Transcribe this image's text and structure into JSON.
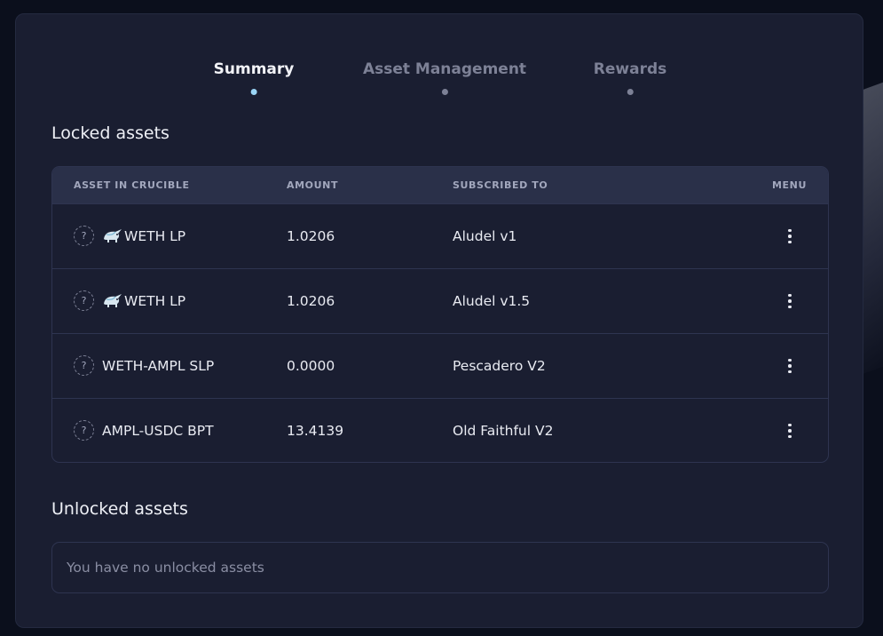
{
  "tabs": [
    {
      "label": "Summary",
      "active": true
    },
    {
      "label": "Asset Management",
      "active": false
    },
    {
      "label": "Rewards",
      "active": false
    }
  ],
  "locked": {
    "title": "Locked assets",
    "headers": {
      "asset": "ASSET IN CRUCIBLE",
      "amount": "AMOUNT",
      "subscribed": "SUBSCRIBED TO",
      "menu": "MENU"
    },
    "rows": [
      {
        "asset": "WETH LP",
        "icon": "unicorn-token-icon",
        "amount": "1.0206",
        "subscribed": "Aludel v1"
      },
      {
        "asset": "WETH LP",
        "icon": "unicorn-token-icon",
        "amount": "1.0206",
        "subscribed": "Aludel v1.5"
      },
      {
        "asset": "WETH-AMPL SLP",
        "icon": "",
        "amount": "0.0000",
        "subscribed": "Pescadero V2"
      },
      {
        "asset": "AMPL-USDC BPT",
        "icon": "",
        "amount": "13.4139",
        "subscribed": "Old Faithful V2"
      }
    ]
  },
  "unlocked": {
    "title": "Unlocked assets",
    "empty_text": "You have no unlocked assets"
  },
  "colors": {
    "background": "#0b0f1c",
    "card": "#1a1e31",
    "header_row": "#2a3049",
    "active_tab_dot": "#9ad4f5"
  }
}
